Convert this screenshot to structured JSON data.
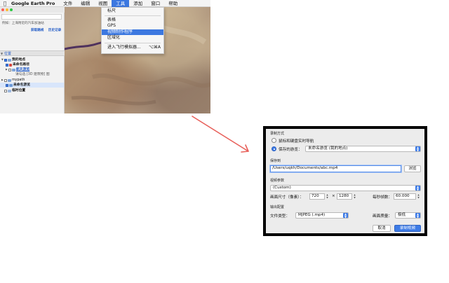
{
  "menubar": {
    "app_name": "Google Earth Pro",
    "items": [
      "文件",
      "编辑",
      "视图",
      "工具",
      "添加",
      "窗口",
      "帮助"
    ],
    "active_item": "工具"
  },
  "tools_menu": {
    "items": [
      {
        "label": "标尺",
        "shortcut": ""
      },
      {
        "label": "表格",
        "shortcut": ""
      },
      {
        "label": "GPS",
        "shortcut": ""
      },
      {
        "label": "视频制作程序",
        "shortcut": ""
      },
      {
        "label": "区域化",
        "shortcut": ""
      },
      {
        "label": "进入飞行模拟器...",
        "shortcut": "⌥⌘A"
      }
    ],
    "highlighted_index": 3
  },
  "left_panel": {
    "search_hint": "例如：上海附近的汽车加油站",
    "search_links": [
      "获取路线",
      "历史记录"
    ],
    "places_header": "位置",
    "tree": [
      {
        "label": "我的地点",
        "bold": true
      },
      {
        "label": "未命名路径",
        "bold": true
      },
      {
        "label": "航天游览",
        "bold": false,
        "link": true
      },
      {
        "label": "请勾选 [3D 建筑物] 图",
        "bold": false
      },
      {
        "label": "mypath",
        "bold": false
      },
      {
        "label": "未命名游览",
        "bold": true
      },
      {
        "label": "临时位置",
        "bold": true
      }
    ]
  },
  "dialog": {
    "record_mode_label": "录制方式",
    "option_live": "鼠标和键盘实时导航",
    "option_tour": "保存的游览：",
    "tour_value": "未命名游览 (我的地点)",
    "save_to_label": "保存到",
    "save_path": "/Users/uqkh/Documents/abc.mp4",
    "browse_button": "浏览",
    "video_params_label": "视频参数",
    "preset_value": "(Custom)",
    "frame_size_label": "画面尺寸（像素）：",
    "width": "720",
    "times": "×",
    "height": "1280",
    "fps_label": "每秒帧数：",
    "fps": "60.000",
    "output_label": "输出配置",
    "file_type_label": "文件类型：",
    "file_type_value": "MJPEG (.mp4)",
    "quality_label": "画面质量：",
    "quality_value": "极低",
    "cancel_button": "取消",
    "record_button": "录制视频"
  },
  "colors": {
    "accent": "#3c78e0",
    "arrow": "#e8605a"
  }
}
